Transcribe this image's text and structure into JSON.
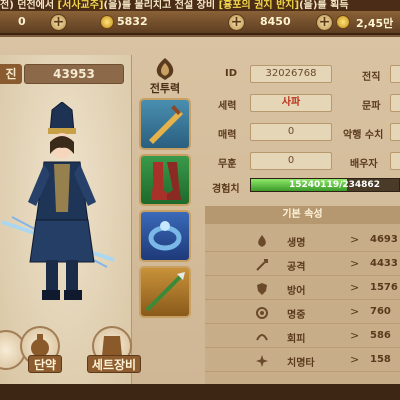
{
  "ticker": {
    "p1": "전) 던전에서 ",
    "item1": "[서사교주]",
    "p2": "(을)를 물리치고 전설 장비 ",
    "item2": "[흉포의 권지 반지]",
    "p3": "(을)를 획득"
  },
  "topbar": {
    "val1": "0",
    "val2": "5832",
    "val3": "8450",
    "val4": "2,45만"
  },
  "character_panel": {
    "power_label": "진",
    "power_value": "43953",
    "btn_danyak": "단약",
    "btn_set": "세트장비"
  },
  "equipment": {
    "title": "전투력"
  },
  "info": {
    "id_label": "ID",
    "id_value": "32026768",
    "job_label": "전직",
    "faction_label": "세력",
    "faction_value": "사파",
    "sect_label": "문파",
    "charm_label": "매력",
    "charm_value": "0",
    "evil_label": "악행 수치",
    "merit_label": "무훈",
    "merit_value": "0",
    "spouse_label": "배우자",
    "exp_label": "경험치",
    "exp_value": "15240119/234862",
    "exp_progress": 0.65
  },
  "stats": {
    "header": "기본 속성",
    "rows": [
      {
        "name": "생명",
        "value": "4693"
      },
      {
        "name": "공격",
        "value": "4433"
      },
      {
        "name": "방어",
        "value": "1576"
      },
      {
        "name": "명중",
        "value": "760"
      },
      {
        "name": "회피",
        "value": "586"
      },
      {
        "name": "치명타",
        "value": "158"
      }
    ]
  }
}
